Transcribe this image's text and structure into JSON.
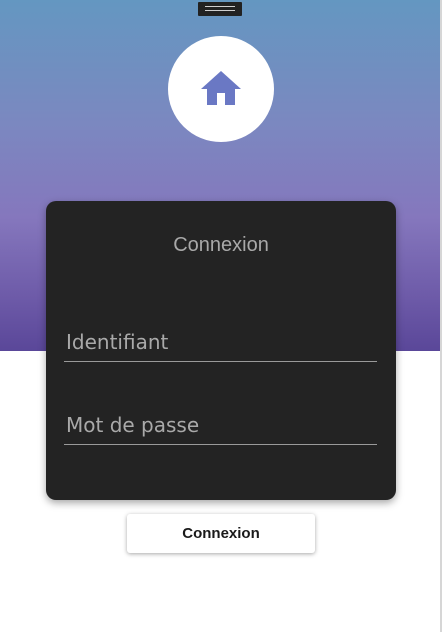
{
  "colors": {
    "gradient_top": "#6497c1",
    "gradient_mid": "#8577bd",
    "gradient_bottom": "#5a4799",
    "card_background": "#232323",
    "logo_icon": "#6a78c4",
    "button_background": "#ffffff"
  },
  "header": {
    "logo_icon": "home-icon"
  },
  "login_card": {
    "title": "Connexion",
    "username": {
      "value": "",
      "placeholder": "Identifiant"
    },
    "password": {
      "value": "",
      "placeholder": "Mot de passe"
    }
  },
  "actions": {
    "login_label": "Connexion"
  }
}
